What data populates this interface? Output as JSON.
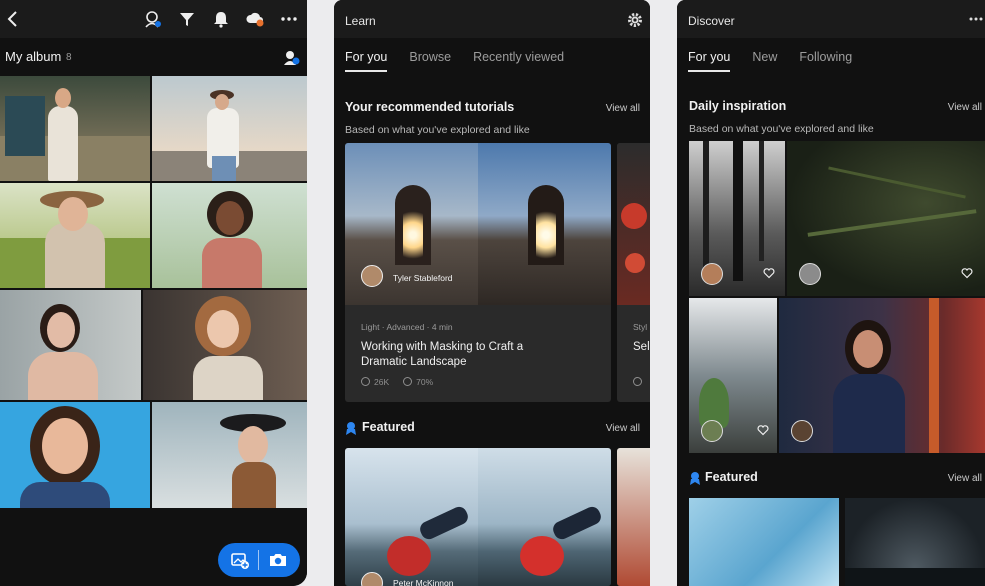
{
  "colors": {
    "accent": "#1473e6",
    "background": "#111111",
    "header": "#1b1b1b",
    "card": "#2a2a2a"
  },
  "album_screen": {
    "icons": [
      "back-icon",
      "people-search-icon",
      "filter-icon",
      "bell-icon",
      "cloud-sync-icon",
      "more-icon"
    ],
    "album_name": "My album",
    "album_count": "8"
  },
  "learn_screen": {
    "title": "Learn",
    "tabs": [
      {
        "label": "For you"
      },
      {
        "label": "Browse"
      },
      {
        "label": "Recently viewed"
      }
    ],
    "recommended": {
      "title": "Your recommended tutorials",
      "subtitle": "Based on what you've explored and like",
      "view_all": "View all",
      "card": {
        "author": "Tyler Stableford",
        "meta": "Light  ·  Advanced  ·  4 min",
        "title_line1": "Working with Masking to Craft a",
        "title_line2": "Dramatic Landscape",
        "views": "26K",
        "rating": "70%"
      },
      "next_card": {
        "meta": "Styl",
        "title": "Sele"
      }
    },
    "featured": {
      "title": "Featured",
      "view_all": "View all",
      "author": "Peter McKinnon"
    }
  },
  "discover_screen": {
    "title": "Discover",
    "tabs": [
      {
        "label": "For you"
      },
      {
        "label": "New"
      },
      {
        "label": "Following"
      }
    ],
    "daily": {
      "title": "Daily inspiration",
      "subtitle": "Based on what you've explored and like",
      "view_all": "View all"
    },
    "featured": {
      "title": "Featured",
      "view_all": "View all"
    }
  }
}
